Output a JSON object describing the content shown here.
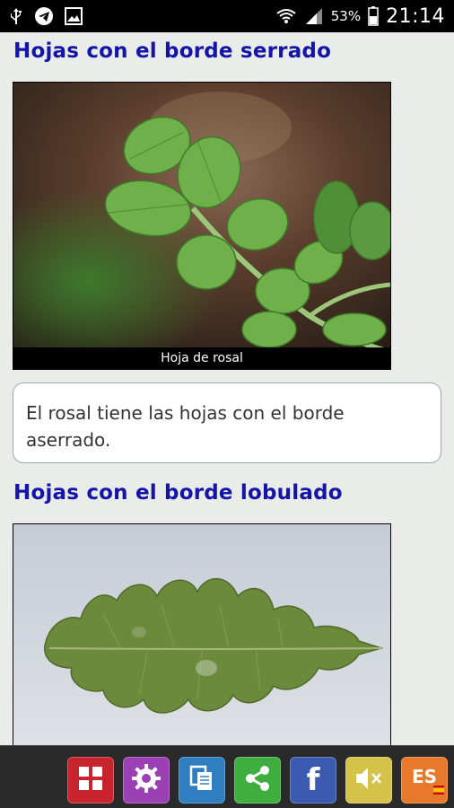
{
  "status_bar": {
    "battery_percent": "53%",
    "time": "21:14",
    "icons": [
      "usb-icon",
      "telegram-icon",
      "gallery-icon",
      "wifi-icon",
      "signal-icon",
      "battery-icon"
    ]
  },
  "sections": [
    {
      "title": "Hojas con el borde serrado",
      "image_caption": "Hoja de rosal",
      "description": "El rosal tiene las hojas con el borde aserrado."
    },
    {
      "title": "Hojas con el borde lobulado"
    }
  ],
  "toolbar": {
    "buttons": [
      {
        "name": "menu",
        "icon": "grid-icon",
        "color": "#c8242e"
      },
      {
        "name": "settings",
        "icon": "gear-icon",
        "color": "#9b3fb5"
      },
      {
        "name": "copy",
        "icon": "copy-icon",
        "color": "#2f7fc0"
      },
      {
        "name": "share",
        "icon": "share-icon",
        "color": "#3fae3f"
      },
      {
        "name": "facebook",
        "icon": "facebook-icon",
        "color": "#3b5bb0",
        "label": "f"
      },
      {
        "name": "mute",
        "icon": "speaker-mute-icon",
        "color": "#d4c24a"
      },
      {
        "name": "language",
        "icon": "language-icon",
        "color": "#e8782a",
        "label": "ES"
      }
    ]
  }
}
